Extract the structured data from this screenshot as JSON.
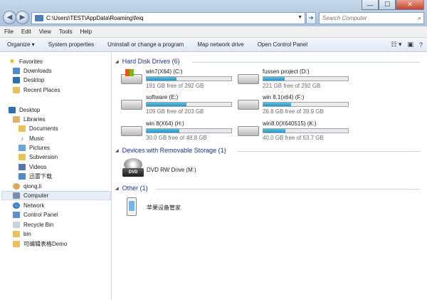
{
  "window": {
    "minimize_glyph": "—",
    "maximize_glyph": "☐",
    "close_glyph": "✕"
  },
  "address": {
    "path": "C:\\Users\\TEST\\AppData\\Roaming\\feiq"
  },
  "search": {
    "placeholder": "Search Computer"
  },
  "menu": [
    "File",
    "Edit",
    "View",
    "Tools",
    "Help"
  ],
  "commands": {
    "organize": "Organize ▾",
    "system_properties": "System properties",
    "uninstall": "Uninstall or change a program",
    "map_network": "Map network drive",
    "control_panel": "Open Control Panel"
  },
  "sidebar": {
    "favorites": "Favorites",
    "downloads": "Downloads",
    "desktop_fav": "Desktop",
    "recent": "Recent Places",
    "desktop": "Desktop",
    "libraries": "Libraries",
    "documents": "Documents",
    "music": "Music",
    "pictures": "Pictures",
    "subversion": "Subversion",
    "videos": "Videos",
    "xunlei": "迅雷下载",
    "user": "qiong.li",
    "computer": "Computer",
    "network": "Network",
    "control_panel": "Control Panel",
    "recycle_bin": "Recycle Bin",
    "bin": "bin",
    "demo": "可编辑表格Demo"
  },
  "groups": {
    "hdd": "Hard Disk Drives (6)",
    "removable": "Devices with Removable Storage (1)",
    "other": "Other (1)"
  },
  "drives": [
    {
      "name": "win7(X64) (C:)",
      "free": "191 GB free of 292 GB",
      "used_fraction": 0.35
    },
    {
      "name": "fussen project (D:)",
      "free": "221 GB free of 292 GB",
      "used_fraction": 0.25
    },
    {
      "name": "software (E:)",
      "free": "109 GB free of 203 GB",
      "used_fraction": 0.47
    },
    {
      "name": "win 8.1(x64) (F:)",
      "free": "26.8 GB free of 39.9 GB",
      "used_fraction": 0.33
    },
    {
      "name": "win 8(X64) (H:)",
      "free": "30.0 GB free of 48.8 GB",
      "used_fraction": 0.39
    },
    {
      "name": "win8.0(X640515) (K:)",
      "free": "40.0 GB free of 53.7 GB",
      "used_fraction": 0.26
    }
  ],
  "dvd": {
    "label": "DVD RW Drive (M:)",
    "badge": "DVD"
  },
  "other_device": {
    "label": "苹果设备管家"
  },
  "colors": {
    "group_header": "#1e3287",
    "bar_fill": "#2793c2",
    "selected_bg": "#e6edf6"
  }
}
